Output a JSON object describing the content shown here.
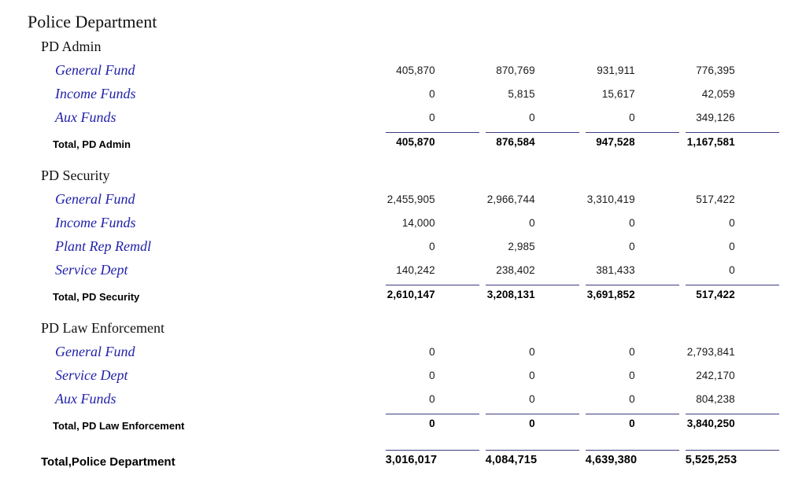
{
  "report": {
    "title": "Police Department",
    "grand_total_label": "Total,Police Department",
    "grand_total_values": [
      "3,016,017",
      "4,084,715",
      "4,639,380",
      "5,525,253"
    ],
    "rule_color": "#3c3c82",
    "item_text_color": "#2222aa",
    "sections": [
      {
        "name": "PD Admin",
        "total_label": "Total, PD Admin",
        "total_values": [
          "405,870",
          "876,584",
          "947,528",
          "1,167,581"
        ],
        "rows": [
          {
            "label": "General Fund",
            "values": [
              "405,870",
              "870,769",
              "931,911",
              "776,395"
            ]
          },
          {
            "label": "Income Funds",
            "values": [
              "0",
              "5,815",
              "15,617",
              "42,059"
            ]
          },
          {
            "label": "Aux Funds",
            "values": [
              "0",
              "0",
              "0",
              "349,126"
            ]
          }
        ]
      },
      {
        "name": "PD Security",
        "total_label": "Total, PD Security",
        "total_values": [
          "2,610,147",
          "3,208,131",
          "3,691,852",
          "517,422"
        ],
        "rows": [
          {
            "label": "General Fund",
            "values": [
              "2,455,905",
              "2,966,744",
              "3,310,419",
              "517,422"
            ]
          },
          {
            "label": "Income Funds",
            "values": [
              "14,000",
              "0",
              "0",
              "0"
            ]
          },
          {
            "label": "Plant Rep Remdl",
            "values": [
              "0",
              "2,985",
              "0",
              "0"
            ]
          },
          {
            "label": "Service Dept",
            "values": [
              "140,242",
              "238,402",
              "381,433",
              "0"
            ]
          }
        ]
      },
      {
        "name": "PD Law Enforcement",
        "total_label": "Total, PD Law Enforcement",
        "total_values": [
          "0",
          "0",
          "0",
          "3,840,250"
        ],
        "rows": [
          {
            "label": "General Fund",
            "values": [
              "0",
              "0",
              "0",
              "2,793,841"
            ]
          },
          {
            "label": "Service Dept",
            "values": [
              "0",
              "0",
              "0",
              "242,170"
            ]
          },
          {
            "label": "Aux Funds",
            "values": [
              "0",
              "0",
              "0",
              "804,238"
            ]
          }
        ]
      }
    ]
  }
}
